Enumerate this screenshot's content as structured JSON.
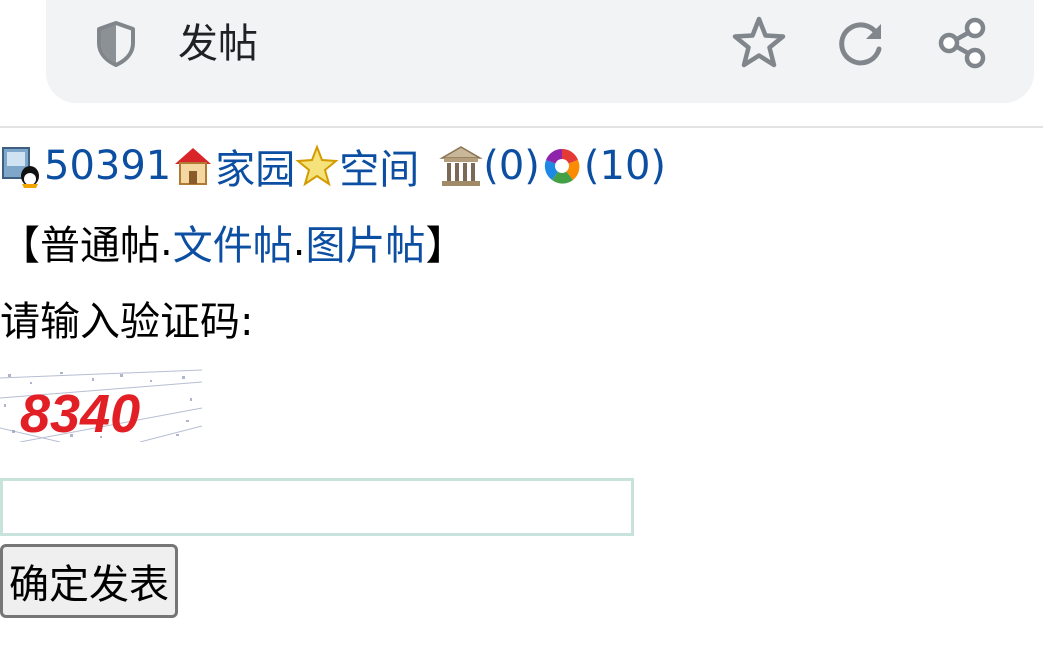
{
  "browser": {
    "page_title": "发帖",
    "icons": [
      "shield-icon",
      "star-icon",
      "reload-icon",
      "share-icon"
    ]
  },
  "user_bar": {
    "user_id": "50391",
    "home_link": "家园",
    "space_link": "空间",
    "mail_count": "(0)",
    "photo_count": "(10)"
  },
  "post_types": {
    "open_bracket": "【",
    "normal": "普通帖",
    "sep1": ".",
    "file": "文件帖",
    "sep2": ".",
    "image": "图片帖",
    "close_bracket": "】"
  },
  "captcha": {
    "prompt": "请输入验证码:",
    "code": "8340",
    "input_value": ""
  },
  "submit_label": "确定发表",
  "colors": {
    "link": "#0b4ea2",
    "toolbar_bg": "#f1f3f4",
    "captcha_text": "#e31f26"
  }
}
